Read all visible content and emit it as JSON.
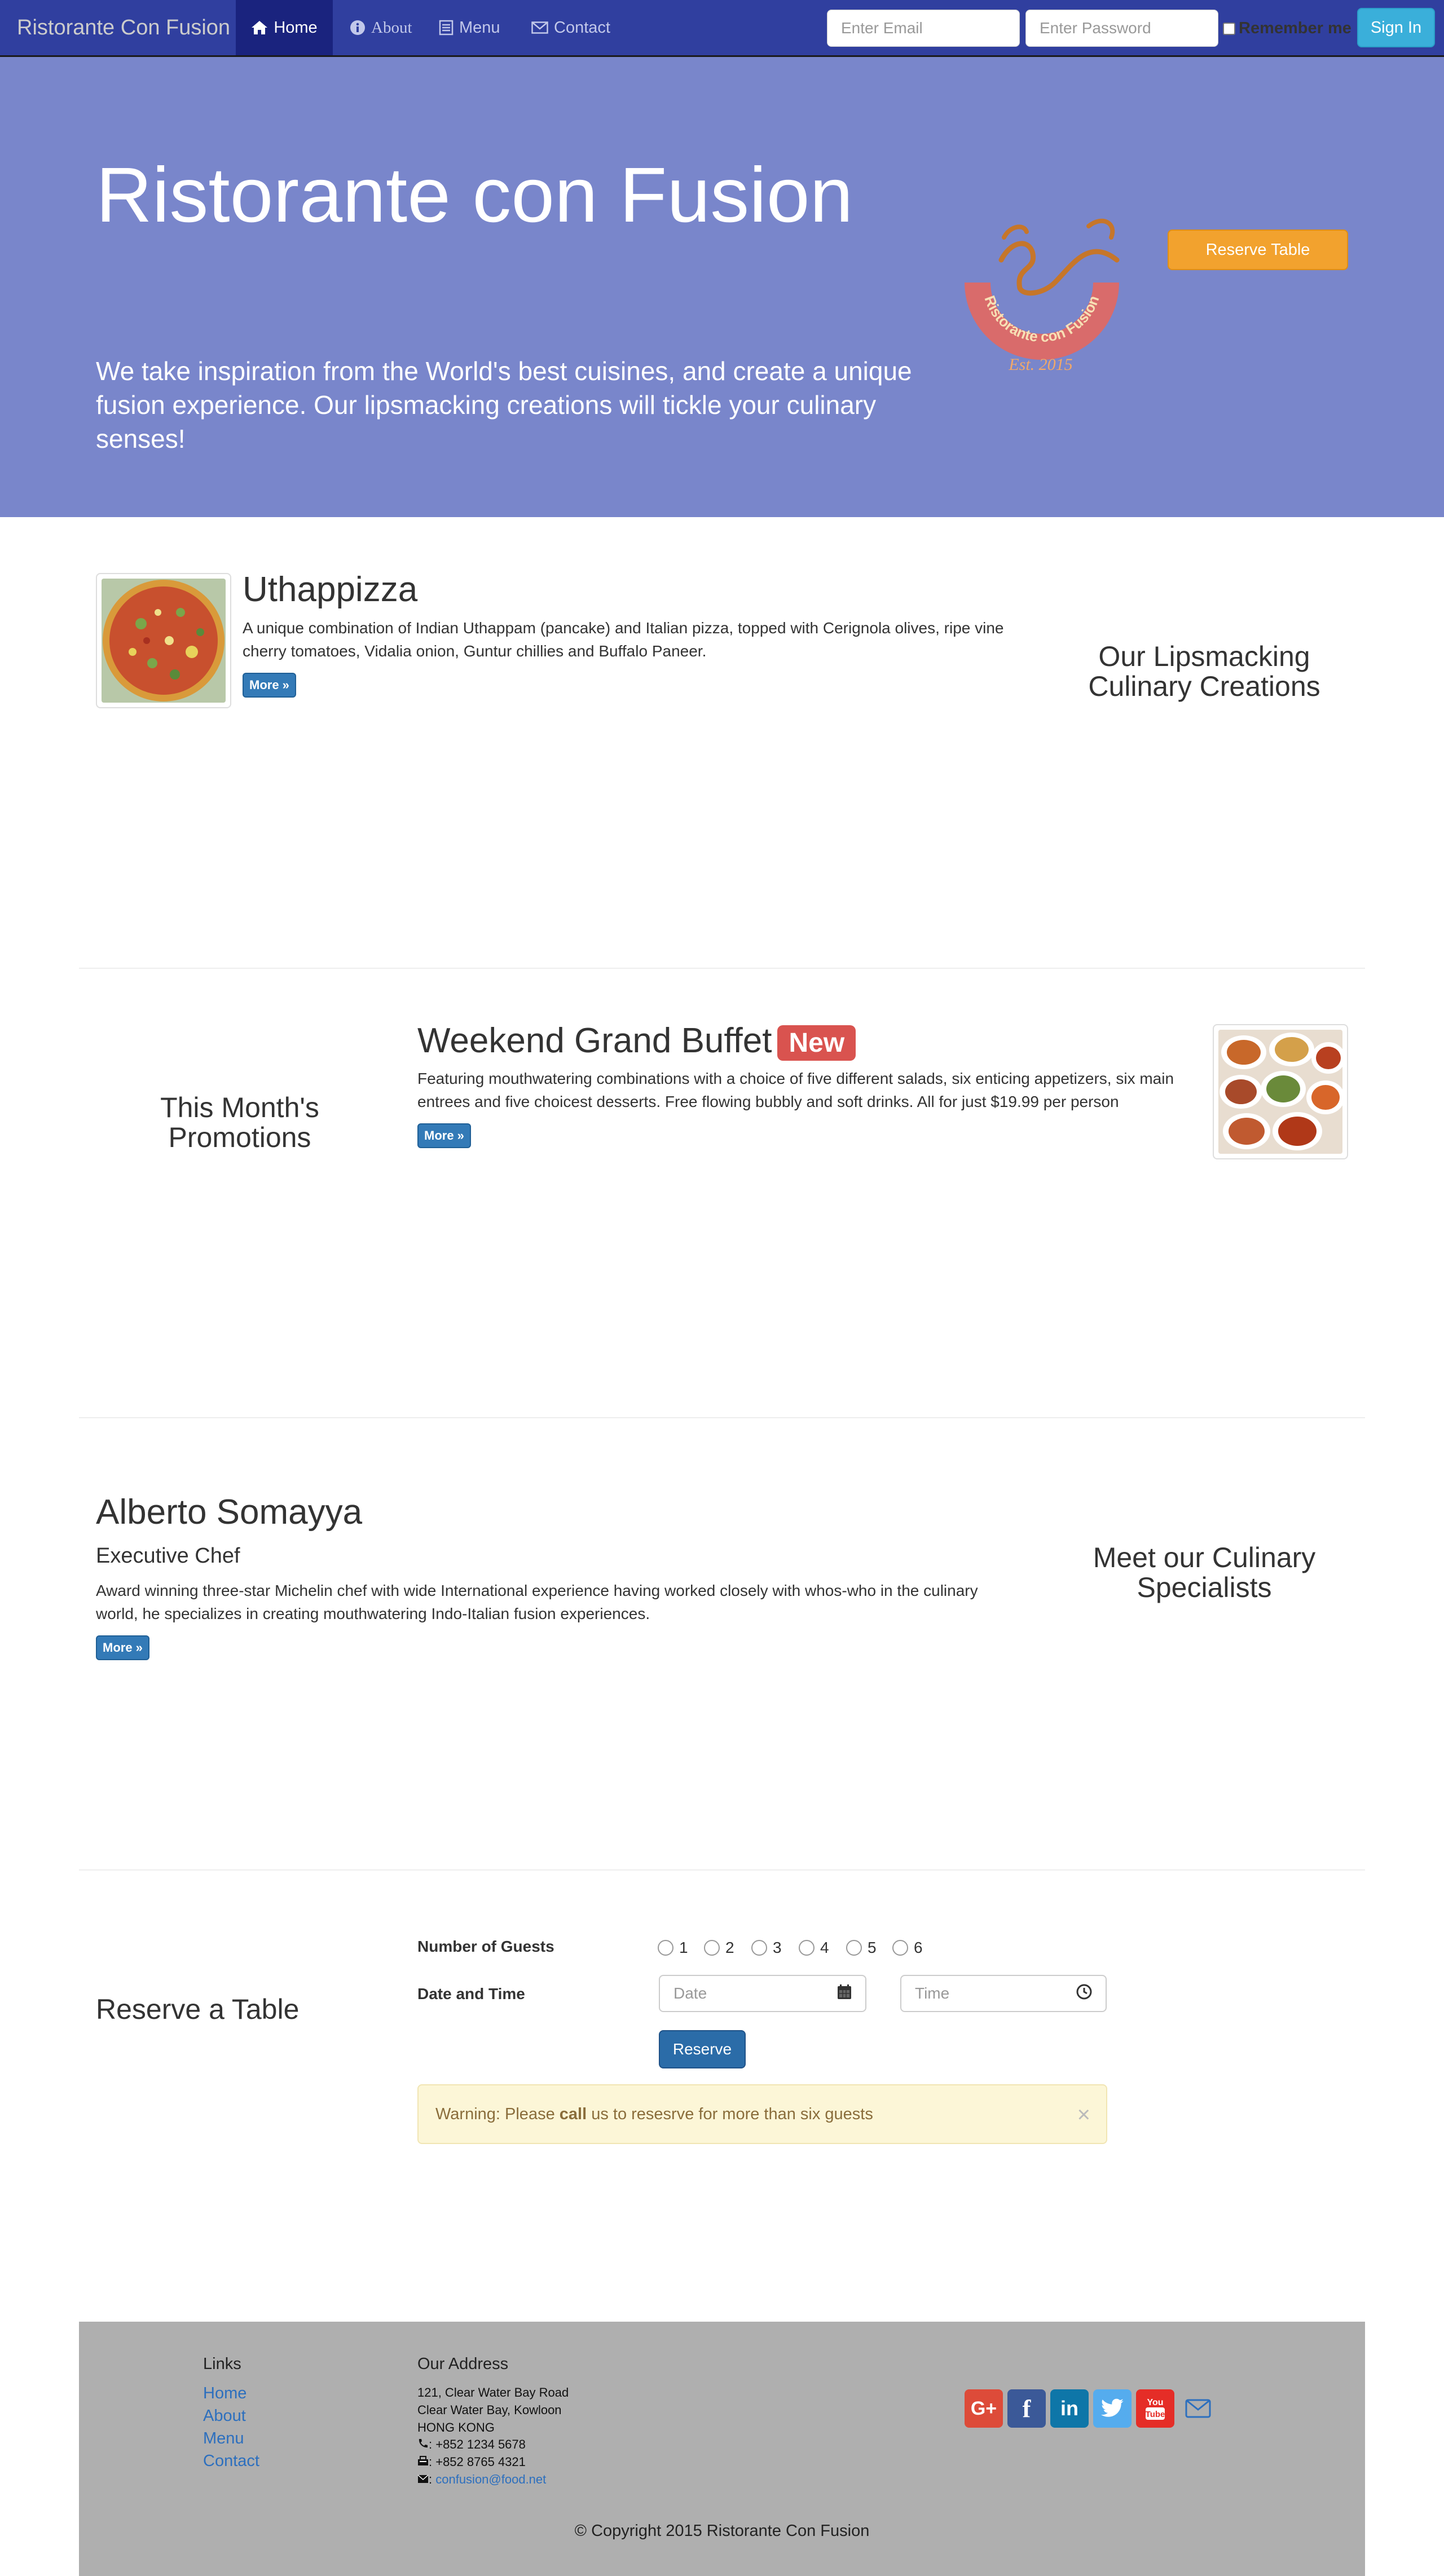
{
  "navbar": {
    "brand": "Ristorante Con Fusion",
    "items": [
      {
        "label": "Home",
        "icon": "home-icon"
      },
      {
        "label": "About",
        "icon": "info-icon"
      },
      {
        "label": "Menu",
        "icon": "list-icon"
      },
      {
        "label": "Contact",
        "icon": "envelope-icon"
      }
    ],
    "email_placeholder": "Enter Email",
    "password_placeholder": "Enter Password",
    "remember_label": "Remember me",
    "signin_label": "Sign In"
  },
  "hero": {
    "title": "Ristorante con Fusion",
    "text": "We take inspiration from the World's best cuisines, and create a unique fusion experience. Our lipsmacking creations will tickle your culinary senses!",
    "logo_text": "Ristorante con Fusion",
    "logo_year": "Est. 2015",
    "reserve_label": "Reserve Table"
  },
  "dish": {
    "title": "Uthappizza",
    "description": "A unique combination of Indian Uthappam (pancake) and Italian pizza, topped with Cerignola olives, ripe vine cherry tomatoes, Vidalia onion, Guntur chillies and Buffalo Paneer.",
    "more_label": "More »",
    "section_heading": "Our Lipsmacking Culinary Creations"
  },
  "promotion": {
    "section_heading": "This Month's Promotions",
    "title": "Weekend Grand Buffet",
    "badge": "New",
    "description": "Featuring mouthwatering combinations with a choice of five different salads, six enticing appetizers, six main entrees and five choicest desserts. Free flowing bubbly and soft drinks. All for just $19.99 per person",
    "more_label": "More »"
  },
  "leader": {
    "name": "Alberto Somayya",
    "designation": "Executive Chef",
    "description": "Award winning three-star Michelin chef with wide International experience having worked closely with whos-who in the culinary world, he specializes in creating mouthwatering Indo-Italian fusion experiences.",
    "more_label": "More »",
    "section_heading": "Meet our Culinary Specialists"
  },
  "reservation": {
    "heading": "Reserve a Table",
    "guests_label": "Number of Guests",
    "guest_options": [
      "1",
      "2",
      "3",
      "4",
      "5",
      "6"
    ],
    "datetime_label": "Date and Time",
    "date_placeholder": "Date",
    "time_placeholder": "Time",
    "submit_label": "Reserve",
    "alert_prefix": "Warning: Please ",
    "alert_bold": "call",
    "alert_suffix": " us to resesrve for more than six guests",
    "alert_close": "×"
  },
  "footer": {
    "links_heading": "Links",
    "links": [
      "Home",
      "About",
      "Menu",
      "Contact"
    ],
    "address_heading": "Our Address",
    "address_lines": [
      "121, Clear Water Bay Road",
      "Clear Water Bay, Kowloon",
      "HONG KONG"
    ],
    "phone": ": +852 1234 5678",
    "fax": ": +852 8765 4321",
    "email": "confusion@food.net",
    "copyright": "© Copyright 2015 Ristorante Con Fusion"
  },
  "colors": {
    "navbar": "#303f9f",
    "navbar_active": "#1a237e",
    "hero": "#7986cb",
    "reserve_button": "#f2a22e",
    "signin_button": "#3aafda",
    "primary_button": "#337ab7",
    "badge_new": "#d9534f",
    "footer": "#afafaf"
  }
}
